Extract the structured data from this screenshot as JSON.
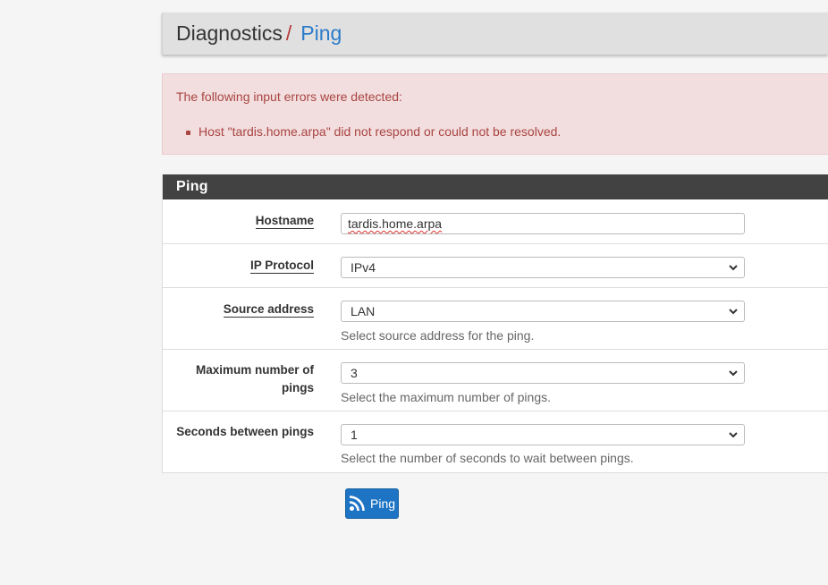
{
  "breadcrumb": {
    "root": "Diagnostics",
    "separator": "/",
    "current": "Ping"
  },
  "alert": {
    "lead": "The following input errors were detected:",
    "errors": [
      "Host \"tardis.home.arpa\" did not respond or could not be resolved."
    ]
  },
  "panel": {
    "title": "Ping",
    "fields": {
      "hostname": {
        "label": "Hostname",
        "value": "tardis.home.arpa"
      },
      "ip_protocol": {
        "label": "IP Protocol",
        "value": "IPv4"
      },
      "source_address": {
        "label": "Source address",
        "value": "LAN",
        "help": "Select source address for the ping."
      },
      "max_pings": {
        "label_line1": "Maximum number of",
        "label_line2": "pings",
        "value": "3",
        "help": "Select the maximum number of pings."
      },
      "seconds_between": {
        "label": "Seconds between pings",
        "value": "1",
        "help": "Select the number of seconds to wait between pings."
      }
    }
  },
  "submit": {
    "label": "Ping",
    "icon": "rss-icon"
  },
  "colors": {
    "accent": "#2b7cc9",
    "button": "#1e74c4",
    "alert_bg": "#f2dede",
    "alert_text": "#a94442",
    "panel_heading": "#424242"
  }
}
